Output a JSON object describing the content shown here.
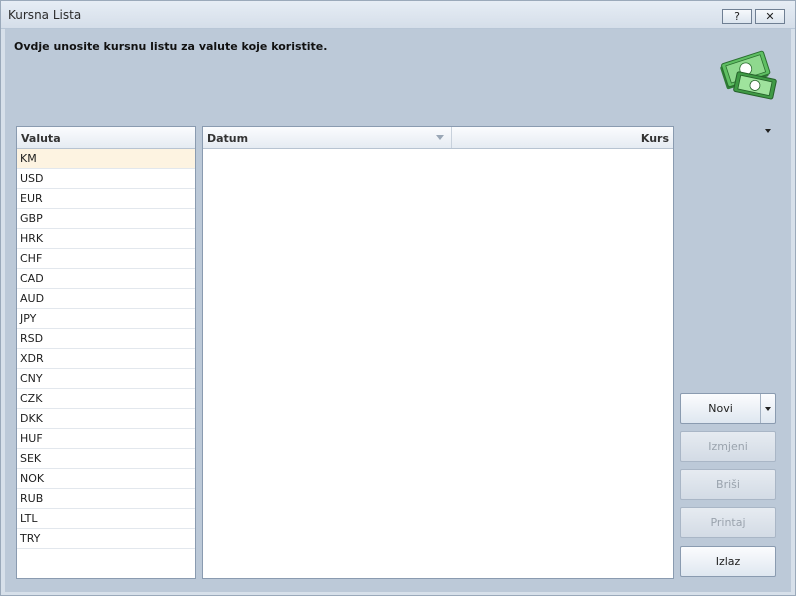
{
  "window": {
    "title": "Kursna Lista",
    "help_label": "?",
    "close_label": "✕"
  },
  "instruction": "Ovdje unosite kursnu listu za valute koje koristite.",
  "currency_list": {
    "header": "Valuta",
    "selected": "KM",
    "items": [
      "KM",
      "USD",
      "EUR",
      "GBP",
      "HRK",
      "CHF",
      "CAD",
      "AUD",
      "JPY",
      "RSD",
      "XDR",
      "CNY",
      "CZK",
      "DKK",
      "HUF",
      "SEK",
      "NOK",
      "RUB",
      "LTL",
      "TRY"
    ]
  },
  "rates_grid": {
    "col_date": "Datum",
    "col_rate": "Kurs"
  },
  "buttons": {
    "new": "Novi",
    "edit": "Izmjeni",
    "delete": "Briši",
    "print": "Printaj",
    "exit": "Izlaz"
  },
  "colors": {
    "background": "#bcc9d8",
    "selected_row": "#fdf3e1",
    "money_green": "#3f9a45"
  }
}
